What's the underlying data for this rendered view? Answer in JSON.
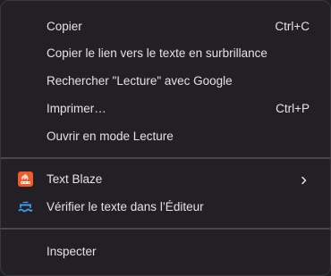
{
  "menu": {
    "items": [
      {
        "label": "Copier",
        "shortcut": "Ctrl+C"
      },
      {
        "label": "Copier le lien vers le texte en surbrillance",
        "shortcut": ""
      },
      {
        "label": "Rechercher \"Lecture\" avec Google",
        "shortcut": ""
      },
      {
        "label": "Imprimer…",
        "shortcut": "Ctrl+P"
      },
      {
        "label": "Ouvrir en mode Lecture",
        "shortcut": ""
      }
    ],
    "extensions": [
      {
        "label": "Text Blaze",
        "icon": "text-blaze-icon",
        "submenu_icon": "chevron-right-icon"
      },
      {
        "label": "Vérifier le texte dans l’Éditeur",
        "icon": "editor-icon"
      }
    ],
    "inspect": {
      "label": "Inspecter"
    }
  },
  "colors": {
    "background": "#221f25",
    "text": "#e6e3e8",
    "separator": "#4a484d",
    "text_blaze_orange": "#f0592a",
    "editor_blue": "#3aa0e8"
  }
}
